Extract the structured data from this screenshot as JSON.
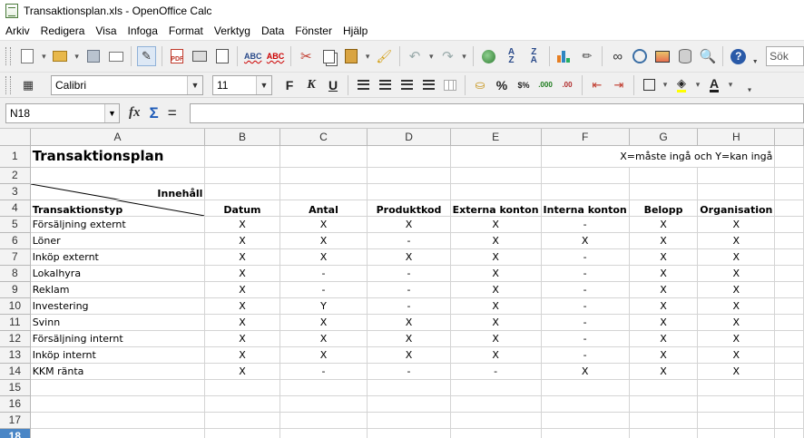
{
  "window": {
    "title": "Transaktionsplan.xls - OpenOffice Calc"
  },
  "menu": [
    "Arkiv",
    "Redigera",
    "Visa",
    "Infoga",
    "Format",
    "Verktyg",
    "Data",
    "Fönster",
    "Hjälp"
  ],
  "toolbar": {
    "search_placeholder": "Sök",
    "font_name": "Calibri",
    "font_size": "11",
    "bold": "F",
    "italic": "K",
    "underline": "U",
    "percent": "%"
  },
  "formula_bar": {
    "cell_ref": "N18",
    "fx": "fx",
    "sigma": "Σ",
    "equals": "="
  },
  "sheet": {
    "columns": [
      "A",
      "B",
      "C",
      "D",
      "E",
      "F",
      "G",
      "H"
    ],
    "row_numbers": [
      "1",
      "2",
      "3",
      "4",
      "5",
      "6",
      "7",
      "8",
      "9",
      "10",
      "11",
      "12",
      "13",
      "14",
      "15",
      "16",
      "17",
      "18"
    ],
    "selected_row": "18",
    "title": "Transaktionsplan",
    "note": "X=måste ingå och Y=kan ingå",
    "corner_top": "Innehåll",
    "corner_bottom": "Transaktionstyp",
    "headers": [
      "Datum",
      "Antal",
      "Produktkod",
      "Externa konton",
      "Interna konton",
      "Belopp",
      "Organisation"
    ],
    "rows": [
      {
        "type": "Försäljning externt",
        "values": [
          "X",
          "X",
          "X",
          "X",
          "-",
          "X",
          "X"
        ]
      },
      {
        "type": "Löner",
        "values": [
          "X",
          "X",
          "-",
          "X",
          "X",
          "X",
          "X"
        ]
      },
      {
        "type": "Inköp externt",
        "values": [
          "X",
          "X",
          "X",
          "X",
          "-",
          "X",
          "X"
        ]
      },
      {
        "type": "Lokalhyra",
        "values": [
          "X",
          "-",
          "-",
          "X",
          "-",
          "X",
          "X"
        ]
      },
      {
        "type": "Reklam",
        "values": [
          "X",
          "-",
          "-",
          "X",
          "-",
          "X",
          "X"
        ]
      },
      {
        "type": "Investering",
        "values": [
          "X",
          "Y",
          "-",
          "X",
          "-",
          "X",
          "X"
        ]
      },
      {
        "type": "Svinn",
        "values": [
          "X",
          "X",
          "X",
          "X",
          "-",
          "X",
          "X"
        ]
      },
      {
        "type": "Försäljning internt",
        "values": [
          "X",
          "X",
          "X",
          "X",
          "-",
          "X",
          "X"
        ]
      },
      {
        "type": "Inköp internt",
        "values": [
          "X",
          "X",
          "X",
          "X",
          "-",
          "X",
          "X"
        ]
      },
      {
        "type": "KKM ränta",
        "values": [
          "X",
          "-",
          "-",
          "-",
          "X",
          "X",
          "X"
        ]
      }
    ]
  }
}
